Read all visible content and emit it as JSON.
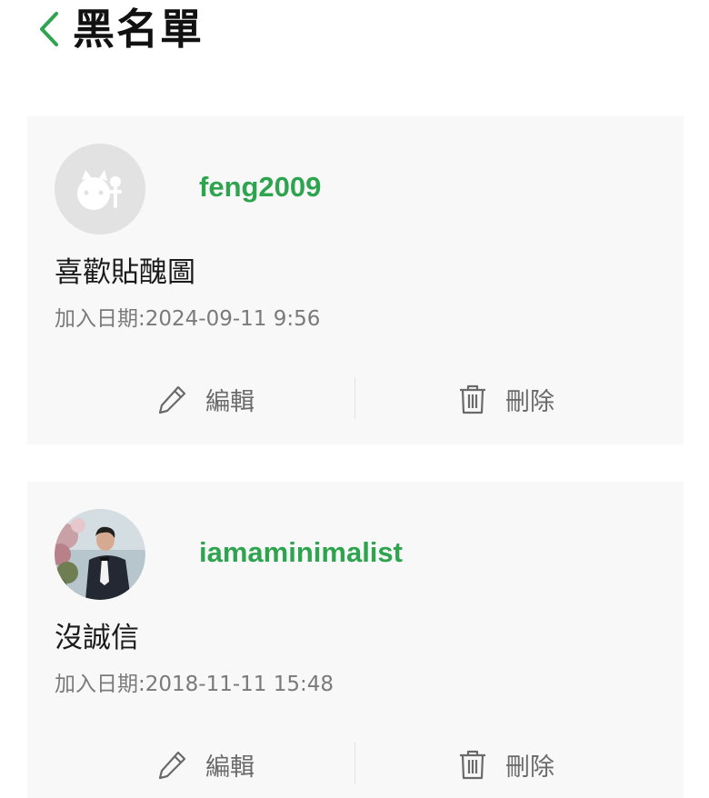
{
  "header": {
    "title": "黑名單"
  },
  "colors": {
    "accent": "#2ea44f",
    "card_background": "#f8f8f8",
    "secondary_text": "#7a7a7a"
  },
  "entries": [
    {
      "username": "feng2009",
      "reason": "喜歡貼醜圖",
      "date_label": "加入日期:",
      "date": "2024-09-11 9:56",
      "avatar": "default-avatar-icon",
      "edit_label": "編輯",
      "delete_label": "刪除"
    },
    {
      "username": "iamaminimalist",
      "reason": "沒誠信",
      "date_label": "加入日期:",
      "date": "2018-11-11 15:48",
      "avatar": "user-photo",
      "edit_label": "編輯",
      "delete_label": "刪除"
    }
  ]
}
